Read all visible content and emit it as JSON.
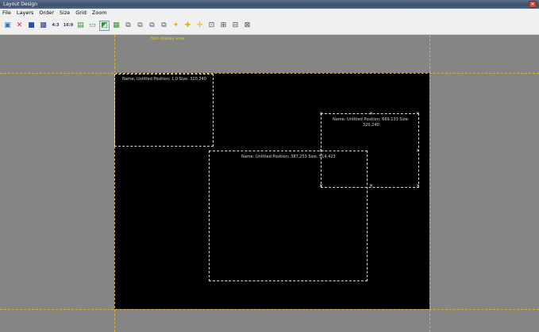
{
  "window": {
    "title": "Layout Design",
    "close_icon": "close-icon"
  },
  "menu": [
    "File",
    "Layers",
    "Order",
    "Size",
    "Grid",
    "Zoom"
  ],
  "toolbar": {
    "icons": [
      "open-icon",
      "delete-icon",
      "save-icon",
      "monitor-icon",
      "ratio-4-3-label",
      "ratio-16-9-label",
      "layer-icon",
      "copy-icon",
      "paste-icon",
      "image-icon",
      "align-left-icon",
      "align-right-icon",
      "align-top-icon",
      "align-bottom-icon",
      "center-h-icon",
      "center-v-icon",
      "move-icon",
      "zoom-fit-icon",
      "zoom-in-icon",
      "zoom-out-icon",
      "zoom-actual-icon"
    ],
    "ratio_4_3": "4:3",
    "ratio_16_9": "16:9"
  },
  "canvas": {
    "non_display_label": "Non-display area",
    "background": "#858585",
    "display_background": "#000000",
    "guide_color": "#d6b13a"
  },
  "layers": [
    {
      "label": "Name: Untitled  Position: 1,0  Size: 320,240"
    },
    {
      "label": "Name: Untitled  Position: 387,253  Size: 514,423"
    },
    {
      "label_line1": "Name: Untitled  Position: 669,133  Size:",
      "label_line2": "320,240"
    }
  ]
}
